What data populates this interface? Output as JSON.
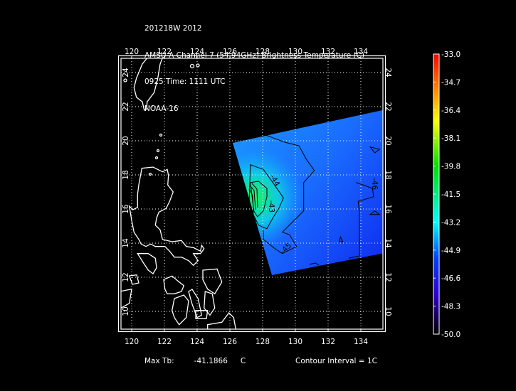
{
  "title": {
    "line1": "201218W 2012",
    "line2": "AMSU-A Channel 7 (54.94GHz) Brightness Temperature (C)",
    "line3": "0925 Time: 1111 UTC",
    "line4": "NOAA-16"
  },
  "map": {
    "lon_labels": [
      "120",
      "122",
      "124",
      "126",
      "128",
      "130",
      "132",
      "134"
    ],
    "lat_labels": [
      "10",
      "12",
      "14",
      "16",
      "18",
      "20",
      "22",
      "24"
    ],
    "contour_labels": [
      "-44",
      "-43",
      "-45",
      "-46"
    ]
  },
  "colorbar": {
    "labels": [
      "-33.0",
      "-34.7",
      "-36.4",
      "-38.1",
      "-39.8",
      "-41.5",
      "-43.2",
      "-44.9",
      "-46.6",
      "-48.3",
      "-50.0"
    ],
    "colors": [
      "#ff0000",
      "#ff8000",
      "#ffff00",
      "#00e000",
      "#00ffff",
      "#0060ff",
      "#2000e0",
      "#300060",
      "#000000"
    ]
  },
  "footer": {
    "max_tb_label": "Max Tb:",
    "max_tb_value": "-41.1866",
    "max_tb_unit": "C",
    "contour_interval": "Contour Interval = 1C"
  }
}
